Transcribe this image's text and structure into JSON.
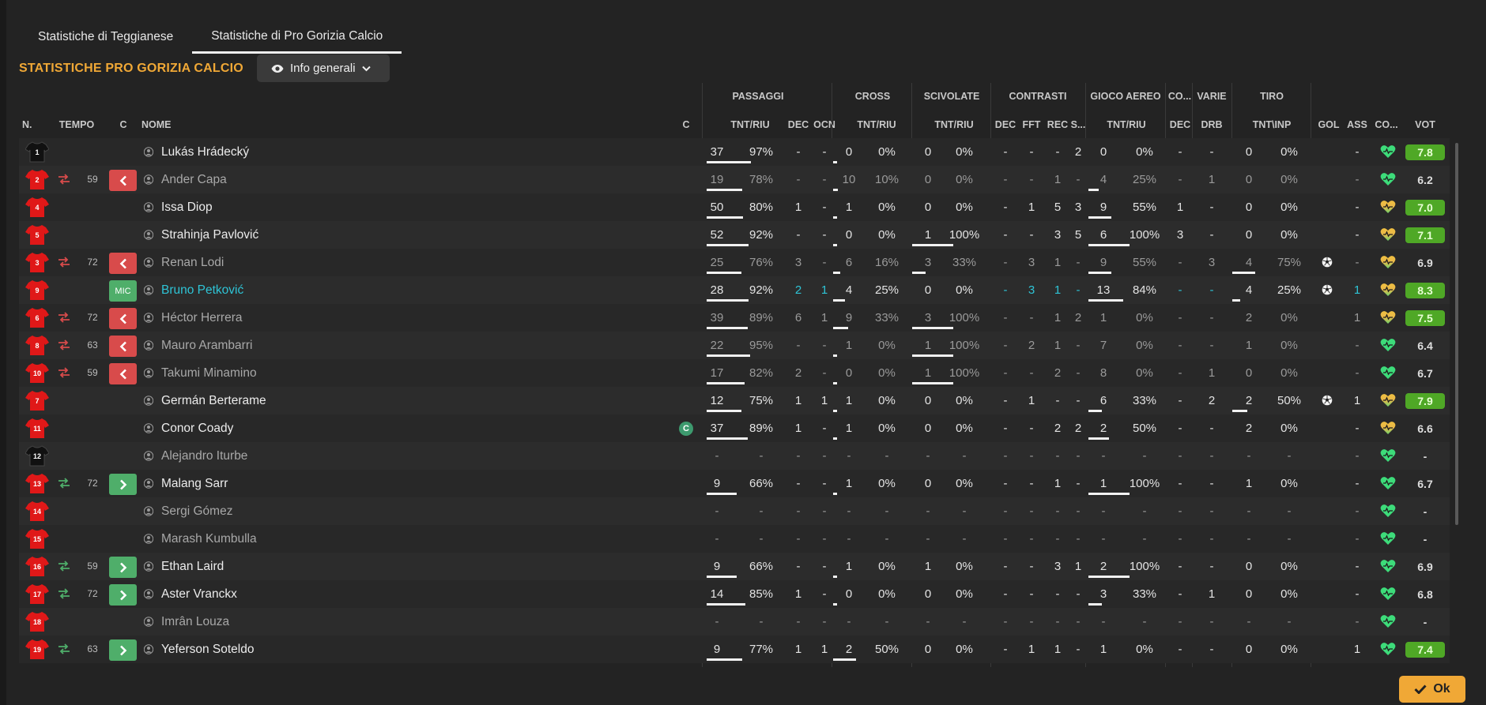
{
  "tabs": [
    "Statistiche di Teggianese",
    "Statistiche di Pro Gorizia Calcio"
  ],
  "active_tab": 1,
  "section_title": "STATISTICHE PRO GORIZIA CALCIO",
  "view_select": "Info generali",
  "ok_label": "Ok",
  "colors": {
    "accent": "#f0a836",
    "good_rating": "#4fa826",
    "highlight": "#2ec4d6",
    "sub_out": "#d84b4b",
    "sub_in": "#4fae6a"
  },
  "groups": [
    "PASSAGGI",
    "CROSS",
    "SCIVOLATE",
    "CONTRASTI",
    "GIOCO AEREO",
    "CO...",
    "VARIE",
    "TIRO"
  ],
  "headers": [
    "N.",
    "TEMPO",
    "C",
    "NOME",
    "C",
    "TNT/RIU",
    "DEC",
    "OCN",
    "TNT/RIU",
    "TNT/RIU",
    "DEC",
    "FFT",
    "REC",
    "S...",
    "TNT/RIU",
    "DEC",
    "DRB",
    "TNT\\INP",
    "GOL",
    "ASS",
    "CO...",
    "VOT"
  ],
  "players": [
    {
      "num": "1",
      "kit": "gk",
      "sub": "",
      "min": "",
      "btn": "",
      "name": "Lukás Hrádecký",
      "capt": "",
      "dim": false,
      "pass": [
        "37",
        "97%"
      ],
      "pdec": "-",
      "ocn": "-",
      "cross": [
        "0",
        "0%"
      ],
      "scv": [
        "0",
        "0%"
      ],
      "cdec": "-",
      "fft": "-",
      "rec": "-",
      "s": "2",
      "aer": [
        "0",
        "0%"
      ],
      "co": "-",
      "drb": "-",
      "tiro": [
        "0",
        "0%"
      ],
      "gol": "",
      "ass": "-",
      "heart": "green",
      "vot": "7.8",
      "good": true
    },
    {
      "num": "2",
      "kit": "out",
      "sub": "out",
      "min": "59",
      "btn": "out",
      "name": "Ander Capa",
      "capt": "",
      "dim": true,
      "pass": [
        "19",
        "78%"
      ],
      "pdec": "-",
      "ocn": "-",
      "cross": [
        "10",
        "10%"
      ],
      "scv": [
        "0",
        "0%"
      ],
      "cdec": "-",
      "fft": "-",
      "rec": "1",
      "s": "-",
      "aer": [
        "4",
        "25%"
      ],
      "co": "-",
      "drb": "1",
      "tiro": [
        "0",
        "0%"
      ],
      "gol": "",
      "ass": "-",
      "heart": "green",
      "vot": "6.2",
      "good": false
    },
    {
      "num": "4",
      "kit": "out",
      "sub": "",
      "min": "",
      "btn": "",
      "name": "Issa Diop",
      "capt": "",
      "dim": false,
      "pass": [
        "50",
        "80%"
      ],
      "pdec": "1",
      "ocn": "-",
      "cross": [
        "1",
        "0%"
      ],
      "scv": [
        "0",
        "0%"
      ],
      "cdec": "-",
      "fft": "1",
      "rec": "5",
      "s": "3",
      "aer": [
        "9",
        "55%"
      ],
      "co": "1",
      "drb": "-",
      "tiro": [
        "0",
        "0%"
      ],
      "gol": "",
      "ass": "-",
      "heart": "yellow",
      "vot": "7.0",
      "good": true
    },
    {
      "num": "5",
      "kit": "out",
      "sub": "",
      "min": "",
      "btn": "",
      "name": "Strahinja Pavlović",
      "capt": "",
      "dim": false,
      "pass": [
        "52",
        "92%"
      ],
      "pdec": "-",
      "ocn": "-",
      "cross": [
        "0",
        "0%"
      ],
      "scv": [
        "1",
        "100%"
      ],
      "cdec": "-",
      "fft": "-",
      "rec": "3",
      "s": "5",
      "aer": [
        "6",
        "100%"
      ],
      "co": "3",
      "drb": "-",
      "tiro": [
        "0",
        "0%"
      ],
      "gol": "",
      "ass": "-",
      "heart": "yellow",
      "vot": "7.1",
      "good": true
    },
    {
      "num": "3",
      "kit": "out",
      "sub": "out",
      "min": "72",
      "btn": "out",
      "name": "Renan Lodi",
      "capt": "",
      "dim": true,
      "pass": [
        "25",
        "76%"
      ],
      "pdec": "3",
      "ocn": "-",
      "cross": [
        "6",
        "16%"
      ],
      "scv": [
        "3",
        "33%"
      ],
      "cdec": "-",
      "fft": "3",
      "rec": "1",
      "s": "-",
      "aer": [
        "9",
        "55%"
      ],
      "co": "-",
      "drb": "3",
      "tiro": [
        "4",
        "75%"
      ],
      "gol": "ball",
      "ass": "-",
      "heart": "yellow",
      "vot": "6.9",
      "good": false
    },
    {
      "num": "9",
      "kit": "out",
      "sub": "",
      "min": "",
      "btn": "pos",
      "name": "Bruno Petković",
      "capt": "",
      "dim": false,
      "hl": true,
      "pass": [
        "28",
        "92%"
      ],
      "pdec": "2",
      "ocn": "1",
      "cross": [
        "4",
        "25%"
      ],
      "scv": [
        "0",
        "0%"
      ],
      "cdec": "-",
      "fft": "3",
      "rec": "1",
      "s": "-",
      "aer": [
        "13",
        "84%"
      ],
      "co": "-",
      "drb": "-",
      "tiro": [
        "4",
        "25%"
      ],
      "gol": "ball",
      "ass": "1",
      "heart": "yellow",
      "vot": "8.3",
      "good": true
    },
    {
      "num": "6",
      "kit": "out",
      "sub": "out",
      "min": "72",
      "btn": "out",
      "name": "Héctor Herrera",
      "capt": "",
      "dim": true,
      "pass": [
        "39",
        "89%"
      ],
      "pdec": "6",
      "ocn": "1",
      "cross": [
        "9",
        "33%"
      ],
      "scv": [
        "3",
        "100%"
      ],
      "cdec": "-",
      "fft": "-",
      "rec": "1",
      "s": "2",
      "aer": [
        "1",
        "0%"
      ],
      "co": "-",
      "drb": "-",
      "tiro": [
        "2",
        "0%"
      ],
      "gol": "",
      "ass": "1",
      "heart": "yellow",
      "vot": "7.5",
      "good": true
    },
    {
      "num": "8",
      "kit": "out",
      "sub": "out",
      "min": "63",
      "btn": "out",
      "name": "Mauro Arambarri",
      "capt": "",
      "dim": true,
      "pass": [
        "22",
        "95%"
      ],
      "pdec": "-",
      "ocn": "-",
      "cross": [
        "1",
        "0%"
      ],
      "scv": [
        "1",
        "100%"
      ],
      "cdec": "-",
      "fft": "2",
      "rec": "1",
      "s": "-",
      "aer": [
        "7",
        "0%"
      ],
      "co": "-",
      "drb": "-",
      "tiro": [
        "1",
        "0%"
      ],
      "gol": "",
      "ass": "-",
      "heart": "green",
      "vot": "6.4",
      "good": false
    },
    {
      "num": "10",
      "kit": "out",
      "sub": "out",
      "min": "59",
      "btn": "out",
      "name": "Takumi Minamino",
      "capt": "",
      "dim": true,
      "pass": [
        "17",
        "82%"
      ],
      "pdec": "2",
      "ocn": "-",
      "cross": [
        "0",
        "0%"
      ],
      "scv": [
        "1",
        "100%"
      ],
      "cdec": "-",
      "fft": "-",
      "rec": "2",
      "s": "-",
      "aer": [
        "8",
        "0%"
      ],
      "co": "-",
      "drb": "1",
      "tiro": [
        "0",
        "0%"
      ],
      "gol": "",
      "ass": "-",
      "heart": "green",
      "vot": "6.7",
      "good": false
    },
    {
      "num": "7",
      "kit": "out",
      "sub": "",
      "min": "",
      "btn": "",
      "name": "Germán Berterame",
      "capt": "",
      "dim": false,
      "pass": [
        "12",
        "75%"
      ],
      "pdec": "1",
      "ocn": "1",
      "cross": [
        "1",
        "0%"
      ],
      "scv": [
        "0",
        "0%"
      ],
      "cdec": "-",
      "fft": "1",
      "rec": "-",
      "s": "-",
      "aer": [
        "6",
        "33%"
      ],
      "co": "-",
      "drb": "2",
      "tiro": [
        "2",
        "50%"
      ],
      "gol": "ball",
      "ass": "1",
      "heart": "yellow",
      "vot": "7.9",
      "good": true
    },
    {
      "num": "11",
      "kit": "out",
      "sub": "",
      "min": "",
      "btn": "",
      "name": "Conor Coady",
      "capt": "C",
      "dim": false,
      "pass": [
        "37",
        "89%"
      ],
      "pdec": "1",
      "ocn": "-",
      "cross": [
        "1",
        "0%"
      ],
      "scv": [
        "0",
        "0%"
      ],
      "cdec": "-",
      "fft": "-",
      "rec": "2",
      "s": "2",
      "aer": [
        "2",
        "50%"
      ],
      "co": "-",
      "drb": "-",
      "tiro": [
        "2",
        "0%"
      ],
      "gol": "",
      "ass": "-",
      "heart": "yellow",
      "vot": "6.6",
      "good": false
    },
    {
      "num": "12",
      "kit": "gk",
      "sub": "",
      "min": "",
      "btn": "",
      "name": "Alejandro Iturbe",
      "capt": "",
      "dim": true,
      "pass": [
        "-",
        "-"
      ],
      "pdec": "-",
      "ocn": "-",
      "cross": [
        "-",
        "-"
      ],
      "scv": [
        "-",
        "-"
      ],
      "cdec": "-",
      "fft": "-",
      "rec": "-",
      "s": "-",
      "aer": [
        "-",
        "-"
      ],
      "co": "-",
      "drb": "-",
      "tiro": [
        "-",
        "-"
      ],
      "gol": "",
      "ass": "-",
      "heart": "green",
      "vot": "-",
      "good": false
    },
    {
      "num": "13",
      "kit": "out",
      "sub": "in",
      "min": "72",
      "btn": "in",
      "name": "Malang Sarr",
      "capt": "",
      "dim": false,
      "pass": [
        "9",
        "66%"
      ],
      "pdec": "-",
      "ocn": "-",
      "cross": [
        "1",
        "0%"
      ],
      "scv": [
        "0",
        "0%"
      ],
      "cdec": "-",
      "fft": "-",
      "rec": "1",
      "s": "-",
      "aer": [
        "1",
        "100%"
      ],
      "co": "-",
      "drb": "-",
      "tiro": [
        "1",
        "0%"
      ],
      "gol": "",
      "ass": "-",
      "heart": "green",
      "vot": "6.7",
      "good": false
    },
    {
      "num": "14",
      "kit": "out",
      "sub": "",
      "min": "",
      "btn": "",
      "name": "Sergi Gómez",
      "capt": "",
      "dim": true,
      "pass": [
        "-",
        "-"
      ],
      "pdec": "-",
      "ocn": "-",
      "cross": [
        "-",
        "-"
      ],
      "scv": [
        "-",
        "-"
      ],
      "cdec": "-",
      "fft": "-",
      "rec": "-",
      "s": "-",
      "aer": [
        "-",
        "-"
      ],
      "co": "-",
      "drb": "-",
      "tiro": [
        "-",
        "-"
      ],
      "gol": "",
      "ass": "-",
      "heart": "green",
      "vot": "-",
      "good": false
    },
    {
      "num": "15",
      "kit": "out",
      "sub": "",
      "min": "",
      "btn": "",
      "name": "Marash Kumbulla",
      "capt": "",
      "dim": true,
      "pass": [
        "-",
        "-"
      ],
      "pdec": "-",
      "ocn": "-",
      "cross": [
        "-",
        "-"
      ],
      "scv": [
        "-",
        "-"
      ],
      "cdec": "-",
      "fft": "-",
      "rec": "-",
      "s": "-",
      "aer": [
        "-",
        "-"
      ],
      "co": "-",
      "drb": "-",
      "tiro": [
        "-",
        "-"
      ],
      "gol": "",
      "ass": "-",
      "heart": "green",
      "vot": "-",
      "good": false
    },
    {
      "num": "16",
      "kit": "out",
      "sub": "in",
      "min": "59",
      "btn": "in",
      "name": "Ethan Laird",
      "capt": "",
      "dim": false,
      "pass": [
        "9",
        "66%"
      ],
      "pdec": "-",
      "ocn": "-",
      "cross": [
        "1",
        "0%"
      ],
      "scv": [
        "1",
        "0%"
      ],
      "cdec": "-",
      "fft": "-",
      "rec": "3",
      "s": "1",
      "aer": [
        "2",
        "100%"
      ],
      "co": "-",
      "drb": "-",
      "tiro": [
        "0",
        "0%"
      ],
      "gol": "",
      "ass": "-",
      "heart": "green",
      "vot": "6.9",
      "good": false
    },
    {
      "num": "17",
      "kit": "out",
      "sub": "in",
      "min": "72",
      "btn": "in",
      "name": "Aster Vranckx",
      "capt": "",
      "dim": false,
      "pass": [
        "14",
        "85%"
      ],
      "pdec": "1",
      "ocn": "-",
      "cross": [
        "0",
        "0%"
      ],
      "scv": [
        "0",
        "0%"
      ],
      "cdec": "-",
      "fft": "-",
      "rec": "-",
      "s": "-",
      "aer": [
        "3",
        "33%"
      ],
      "co": "-",
      "drb": "1",
      "tiro": [
        "0",
        "0%"
      ],
      "gol": "",
      "ass": "-",
      "heart": "green",
      "vot": "6.8",
      "good": false
    },
    {
      "num": "18",
      "kit": "out",
      "sub": "",
      "min": "",
      "btn": "",
      "name": "Imrân Louza",
      "capt": "",
      "dim": true,
      "pass": [
        "-",
        "-"
      ],
      "pdec": "-",
      "ocn": "-",
      "cross": [
        "-",
        "-"
      ],
      "scv": [
        "-",
        "-"
      ],
      "cdec": "-",
      "fft": "-",
      "rec": "-",
      "s": "-",
      "aer": [
        "-",
        "-"
      ],
      "co": "-",
      "drb": "-",
      "tiro": [
        "-",
        "-"
      ],
      "gol": "",
      "ass": "-",
      "heart": "green",
      "vot": "-",
      "good": false
    },
    {
      "num": "19",
      "kit": "out",
      "sub": "in",
      "min": "63",
      "btn": "in",
      "name": "Yeferson Soteldo",
      "capt": "",
      "dim": false,
      "pass": [
        "9",
        "77%"
      ],
      "pdec": "1",
      "ocn": "1",
      "cross": [
        "2",
        "50%"
      ],
      "scv": [
        "0",
        "0%"
      ],
      "cdec": "-",
      "fft": "1",
      "rec": "1",
      "s": "-",
      "aer": [
        "1",
        "0%"
      ],
      "co": "-",
      "drb": "-",
      "tiro": [
        "0",
        "0%"
      ],
      "gol": "",
      "ass": "1",
      "heart": "green",
      "vot": "7.4",
      "good": true
    }
  ],
  "pos_label": "MIC"
}
